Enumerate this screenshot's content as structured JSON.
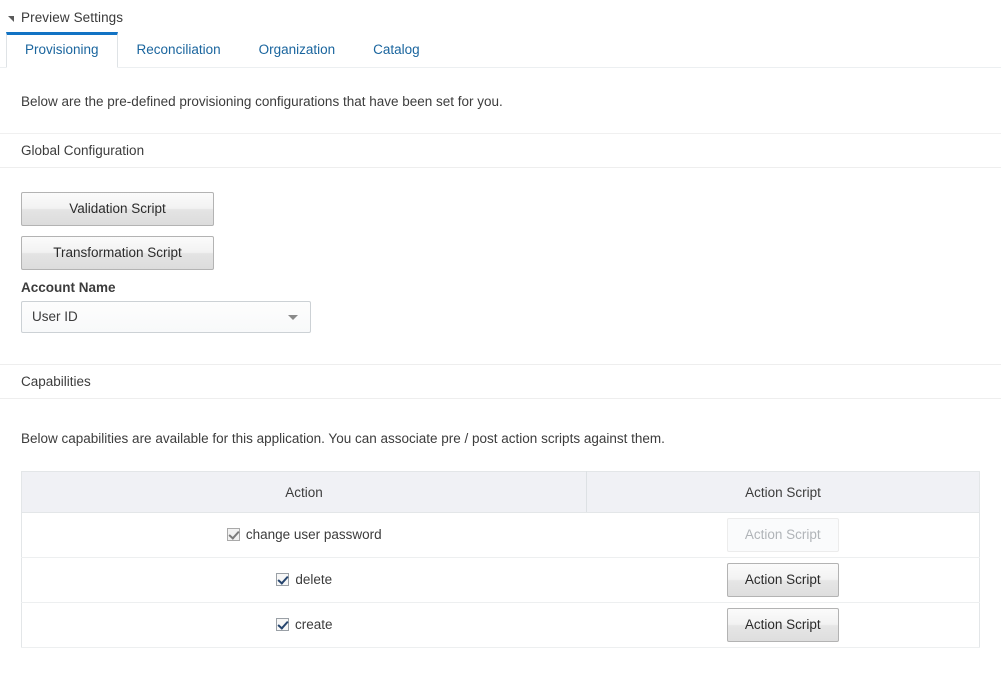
{
  "panel": {
    "title": "Preview Settings",
    "disclosure_icon": "triangle-collapse-icon"
  },
  "tabs": [
    {
      "label": "Provisioning",
      "active": true
    },
    {
      "label": "Reconciliation",
      "active": false
    },
    {
      "label": "Organization",
      "active": false
    },
    {
      "label": "Catalog",
      "active": false
    }
  ],
  "main": {
    "intro_text": "Below are the pre-defined provisioning configurations that have been set for you.",
    "global_configuration_header": "Global Configuration",
    "validation_script_label": "Validation Script",
    "transformation_script_label": "Transformation Script",
    "account_name_label": "Account Name",
    "account_name_value": "User ID",
    "account_name_arrow_icon": "chevron-down-icon",
    "capabilities_header": "Capabilities",
    "capabilities_text": "Below capabilities are available for this application. You can associate pre / post action scripts against them."
  },
  "table": {
    "columns": [
      "Action",
      "Action Script"
    ],
    "rows": [
      {
        "checked": true,
        "checkbox_state": "checked-disabled",
        "action": "change user password",
        "button_label": "Action Script",
        "button_disabled": true
      },
      {
        "checked": true,
        "checkbox_state": "checked",
        "action": "delete",
        "button_label": "Action Script",
        "button_disabled": false
      },
      {
        "checked": true,
        "checkbox_state": "checked",
        "action": "create",
        "button_label": "Action Script",
        "button_disabled": false
      }
    ]
  },
  "colors": {
    "tab_blue": "#1a659e",
    "active_tab_border": "#1273c4",
    "header_bg": "#f0f1f5",
    "text": "#3c3c3c"
  }
}
